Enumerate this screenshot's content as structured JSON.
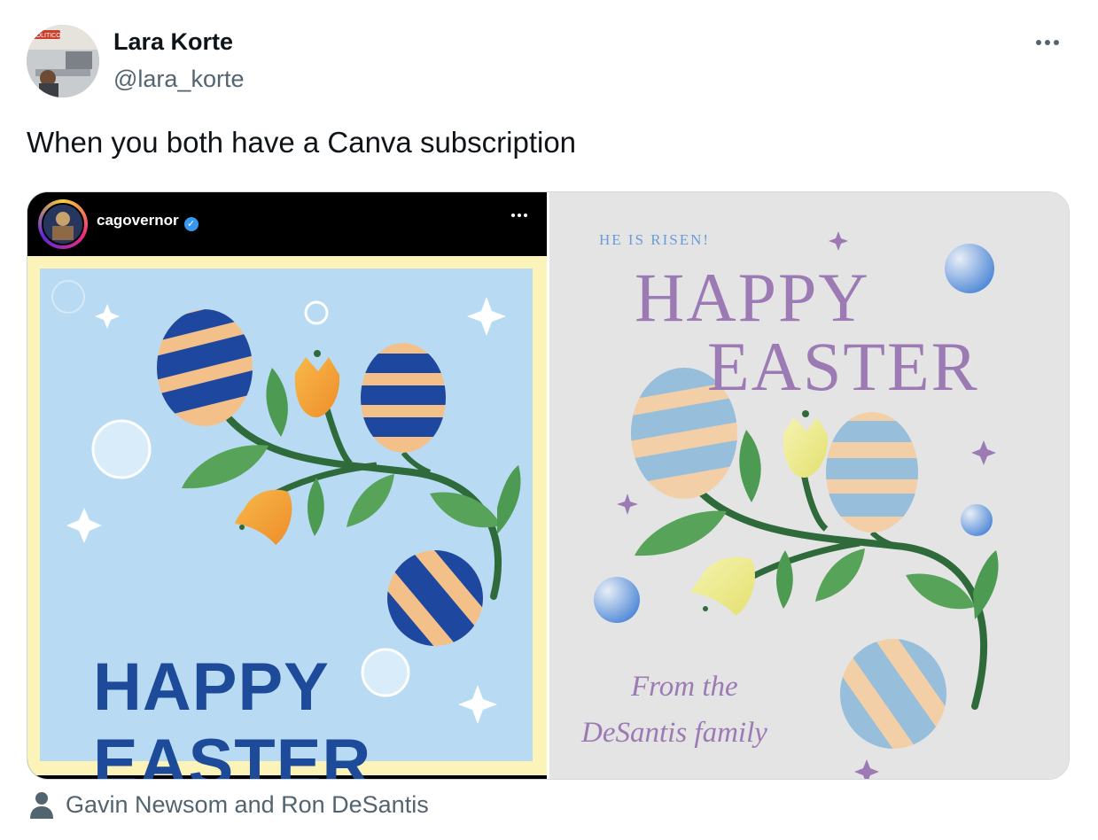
{
  "author": {
    "name": "Lara Korte",
    "handle": "@lara_korte",
    "avatar_badge_text": "POLITICO"
  },
  "tweet": {
    "text": "When you both have a Canva subscription"
  },
  "media": {
    "left_post": {
      "username": "cagovernor",
      "verified_icon": "✓",
      "card_title_line1": "HAPPY",
      "card_title_line2": "EASTER",
      "colors": {
        "background": "#b8dbf3",
        "border": "#fbf3b8",
        "text": "#1d4a99"
      }
    },
    "right_post": {
      "kicker": "HE IS RISEN!",
      "title_line1": "HAPPY",
      "title_line2": "EASTER",
      "signoff_line1": "From the",
      "signoff_line2": "DeSantis family",
      "colors": {
        "background": "#e4e4e4",
        "text": "#9c7ab4",
        "kicker": "#6a9cd8"
      }
    }
  },
  "tagged_people": "Gavin Newsom and Ron DeSantis",
  "icons": [
    "more-options-icon",
    "verified-badge-icon",
    "person-tag-icon"
  ]
}
